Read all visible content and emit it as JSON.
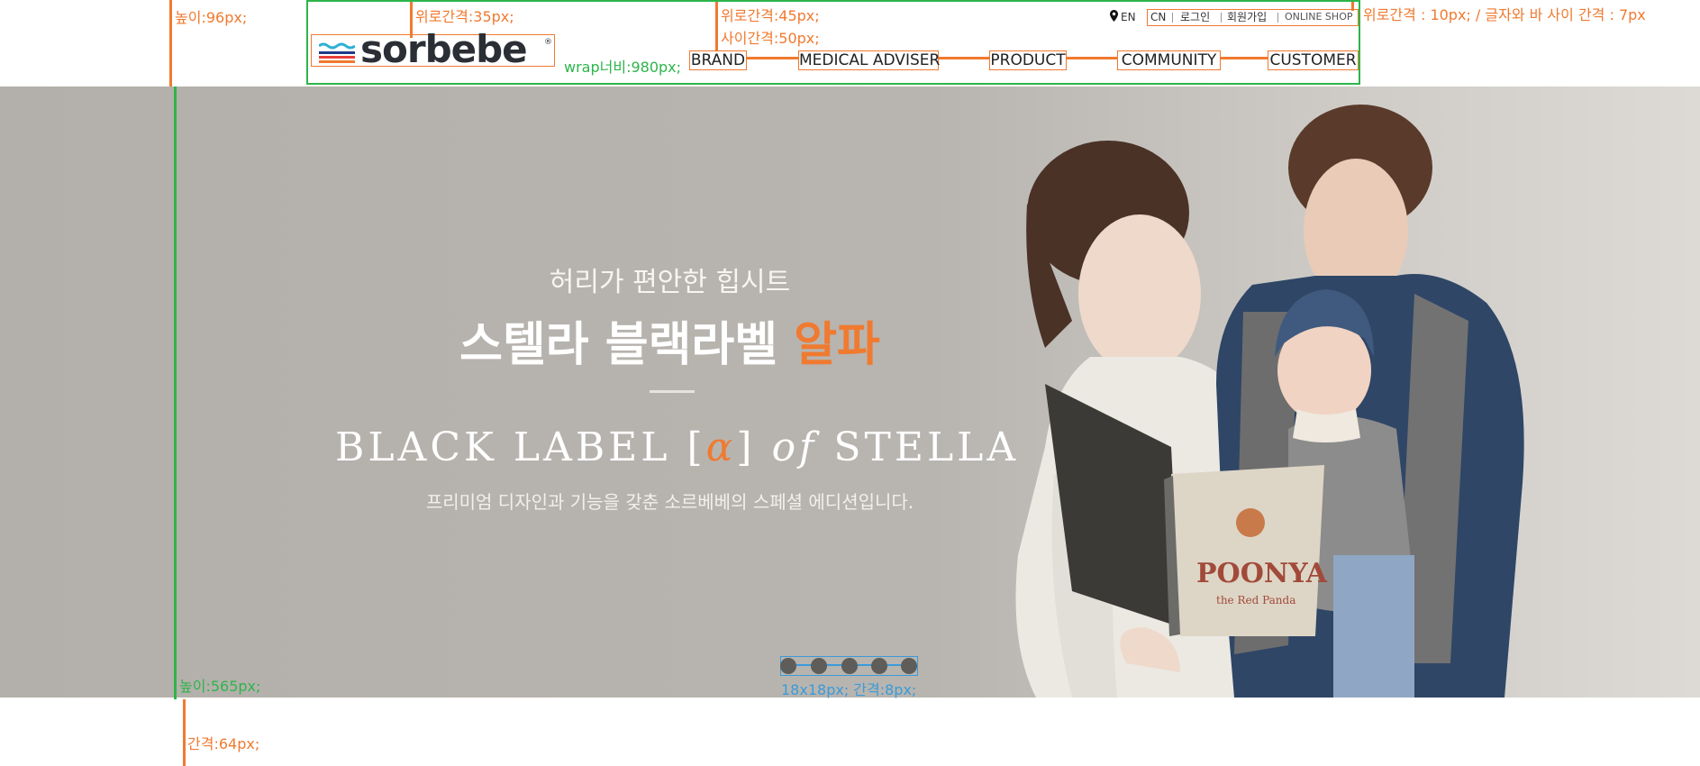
{
  "header": {
    "logo": "sorbebe",
    "lang_current": "EN",
    "utility": [
      "CN",
      "로그인",
      "회원가입",
      "ONLINE SHOP"
    ],
    "menu": [
      "BRAND",
      "MEDICAL ADVISER",
      "PRODUCT",
      "COMMUNITY",
      "CUSTOMER"
    ]
  },
  "hero": {
    "subtitle": "허리가 편안한 힙시트",
    "title_main": "스텔라 블랙라벨",
    "title_accent": "알파",
    "en_part1": "BLACK LABEL [",
    "en_alpha": "α",
    "en_part2": "]",
    "en_of": "of",
    "en_part3": "STELLA",
    "description": "프리미엄 디자인과 기능을 갖춘 소르베베의 스페셜 에디션입니다.",
    "book_title": "POONYA",
    "book_subtitle": "the Red Panda",
    "slide_count": 5
  },
  "annotations": {
    "height_header": "높이:96px;",
    "top_gap_logo": "위로간격:35px;",
    "top_gap_menu": "위로간격:45px;",
    "gap_menu": "사이간격:50px;",
    "util_spacing": "위로간격 : 10px; / 글자와 바 사이 간격 : 7px",
    "wrap_width": "wrap너비:980px;",
    "height_hero": "높이:565px;",
    "dots_size": "18x18px; 간격:8px;",
    "gap_bottom": "간격:64px;"
  },
  "colors": {
    "accent_orange": "#f07a30",
    "guide_green": "#2db54a",
    "guide_blue": "#3a9bd9",
    "dot": "#5f5d5a"
  }
}
